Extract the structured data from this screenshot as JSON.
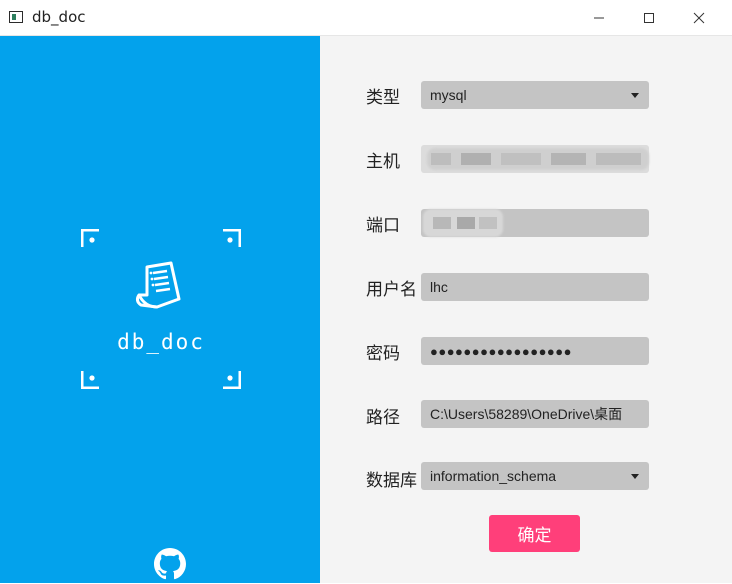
{
  "window": {
    "title": "db_doc"
  },
  "sidebar": {
    "logo_text": "db_doc",
    "background": "#03A2EC"
  },
  "form": {
    "type_label": "类型",
    "type_value": "mysql",
    "host_label": "主机",
    "host_value": "",
    "port_label": "端口",
    "port_value": "",
    "user_label": "用户名",
    "user_value": "lhc",
    "password_label": "密码",
    "password_value": "●●●●●●●●●●●●●●●●●",
    "path_label": "路径",
    "path_value": "C:\\Users\\58289\\OneDrive\\桌面",
    "database_label": "数据库",
    "database_value": "information_schema"
  },
  "actions": {
    "confirm_label": "确定",
    "confirm_color": "#FF3F7A"
  }
}
